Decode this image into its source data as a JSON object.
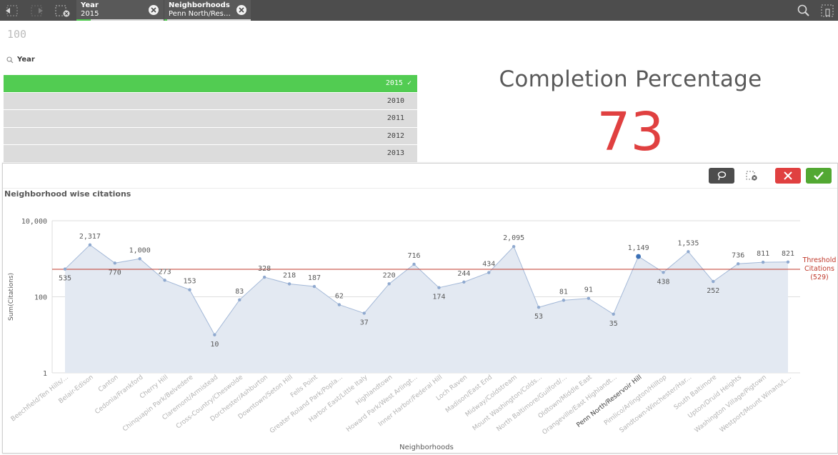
{
  "toolbar": {
    "icons": [
      "step-back-icon",
      "step-forward-icon",
      "clear-selections-icon",
      "search-icon",
      "selections-tool-icon"
    ],
    "chips": [
      {
        "title": "Year",
        "value": "2015"
      },
      {
        "title": "Neighborhoods",
        "value": "Penn North/Rese..."
      }
    ]
  },
  "kpi_small": {
    "value": "100"
  },
  "filter": {
    "title": "Year",
    "items": [
      {
        "label": "2015 ✓",
        "selected": true
      },
      {
        "label": "2010",
        "selected": false
      },
      {
        "label": "2011",
        "selected": false
      },
      {
        "label": "2012",
        "selected": false
      },
      {
        "label": "2013",
        "selected": false
      }
    ]
  },
  "kpi": {
    "title": "Completion Percentage",
    "value": "73",
    "color": "#e04040"
  },
  "colors": {
    "selected_green": "#52cc52",
    "accent_red": "#e04040",
    "area_fill": "#e3e9f2",
    "line": "#a4b9d8",
    "threshold": "#c0392b"
  },
  "panel": {
    "title": "Neighborhood wise citations"
  },
  "chart_data": {
    "type": "area",
    "title": "Neighborhood wise citations",
    "xlabel": "Neighborhoods",
    "ylabel": "Sum(Citations)",
    "yscale": "log",
    "ylim": [
      1,
      10000
    ],
    "yticks": [
      "1",
      "100",
      "10,000"
    ],
    "categories": [
      "Beechfield/Ten Hills/...",
      "Belair-Edison",
      "Canton",
      "Cedonia/Frankford",
      "Cherry Hill",
      "Chinquapin Park/Belvedere",
      "Claremont/Armistead",
      "Cross-Country/Cheswolde",
      "Dorchester/Ashburton",
      "Downtown/Seton Hill",
      "Fells Point",
      "Greater Roland Park/Popla...",
      "Harbor East/Little Italy",
      "Highlandtown",
      "Howard Park/West Arlingt...",
      "Inner Harbor/Federal Hill",
      "Loch Raven",
      "Madison/East End",
      "Midway/Coldstream",
      "Mount Washington/Colds...",
      "North Baltimore/Guilford/...",
      "Oldtown/Middle East",
      "Orangeville/East Highlandt...",
      "Penn North/Reservoir Hill",
      "Pimlico/Arlington/Hilltop",
      "Sandtown-Winchester/Har...",
      "South Baltimore",
      "Upton/Druid Heights",
      "Washington Village/Pigtown",
      "Westport/Mount Winans/L..."
    ],
    "values": [
      535,
      2317,
      770,
      1000,
      273,
      153,
      10,
      83,
      328,
      218,
      187,
      62,
      37,
      220,
      716,
      174,
      244,
      434,
      2095,
      53,
      81,
      91,
      35,
      1149,
      438,
      1535,
      252,
      736,
      811,
      821
    ],
    "value_labels": [
      "535",
      "2,317",
      "770",
      "1,000",
      "273",
      "153",
      "10",
      "83",
      "328",
      "218",
      "187",
      "62",
      "37",
      "220",
      "716",
      "174",
      "244",
      "434",
      "2,095",
      "53",
      "81",
      "91",
      "35",
      "1,149",
      "438",
      "1,535",
      "252",
      "736",
      "811",
      "821"
    ],
    "selected_category": "Penn North/Reservoir Hill",
    "threshold": {
      "value": 529,
      "label_lines": [
        "Threshold",
        "Citations",
        "(529)"
      ]
    },
    "grid": true
  }
}
